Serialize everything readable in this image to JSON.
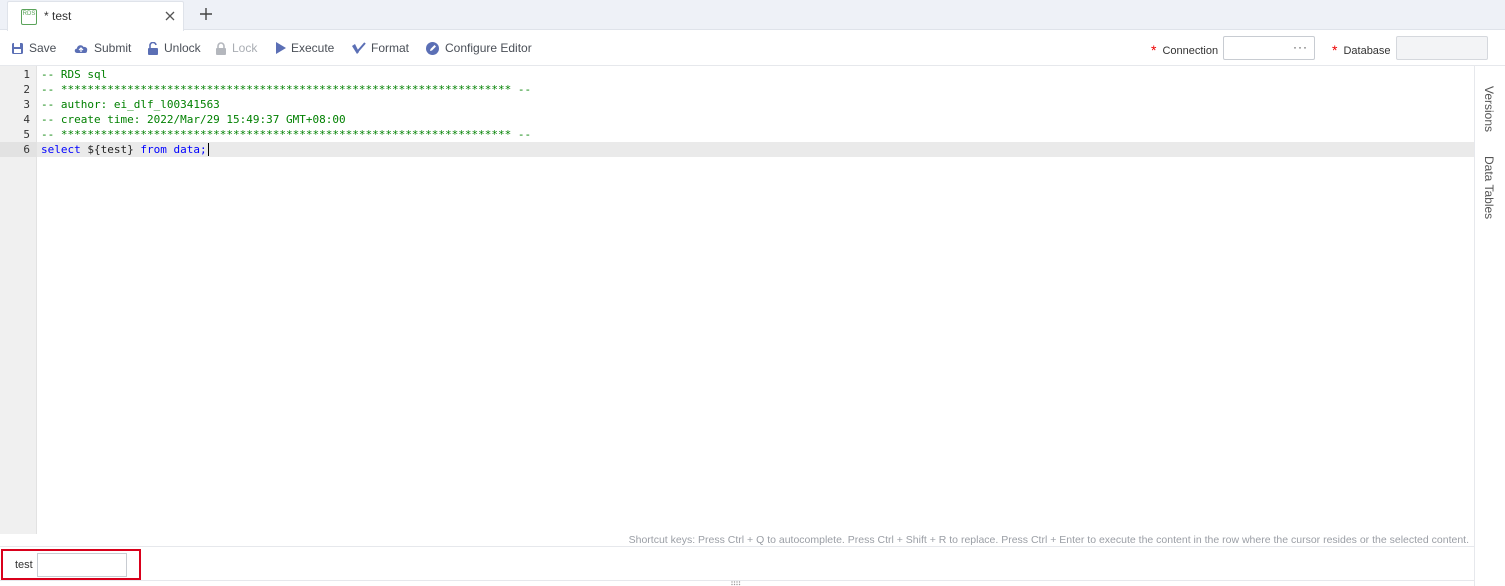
{
  "tabs": [
    {
      "icon_text": "RDS",
      "title": "* test"
    }
  ],
  "toolbar": {
    "save": "Save",
    "submit": "Submit",
    "unlock": "Unlock",
    "lock": "Lock",
    "execute": "Execute",
    "format": "Format",
    "configure_editor": "Configure Editor",
    "connection_label": "Connection",
    "connection_dots": "···",
    "database_label": "Database",
    "required_mark": "*"
  },
  "editor": {
    "lines": [
      {
        "num": "1",
        "text": "-- RDS sql"
      },
      {
        "num": "2",
        "text": "-- ******************************************************************** --"
      },
      {
        "num": "3",
        "text": "-- author: ei_dlf_l00341563"
      },
      {
        "num": "4",
        "text": "-- create time: 2022/Mar/29 15:49:37 GMT+08:00"
      },
      {
        "num": "5",
        "text": "-- ******************************************************************** --"
      },
      {
        "num": "6",
        "kw1": "select",
        "mid": " ${test} ",
        "kw2": "from",
        "end": " data;"
      }
    ]
  },
  "side_panel": {
    "versions": "Versions",
    "data_tables": "Data Tables"
  },
  "hint": "Shortcut keys: Press Ctrl + Q to autocomplete. Press Ctrl + Shift + R to replace. Press Ctrl + Enter to execute the content in the row where the cursor resides or the selected content.",
  "params": {
    "label": "test",
    "value": ""
  },
  "colors": {
    "comment": "#008000",
    "keyword": "#0000ff",
    "highlight_border": "#d9001b",
    "icon_blue": "#5b6fb5"
  }
}
